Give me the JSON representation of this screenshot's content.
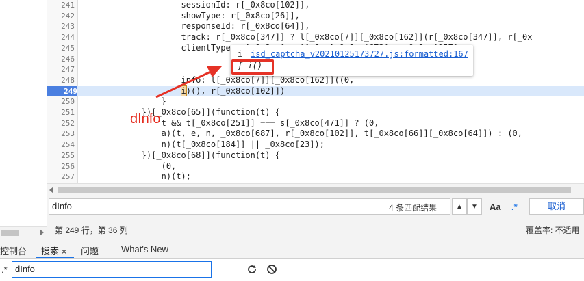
{
  "editor": {
    "lines": [
      {
        "n": "241",
        "code": "                    sessionId: r[_0x8co[102]],"
      },
      {
        "n": "242",
        "code": "                    showType: r[_0x8co[26]],"
      },
      {
        "n": "243",
        "code": "                    responseId: r[_0x8co[64]],"
      },
      {
        "n": "244",
        "code": "                    track: r[_0x8co[347]] ? l[_0x8co[7]][_0x8co[162]](r[_0x8co[347]], r[_0x"
      },
      {
        "n": "245",
        "code": "                    clientType: r[_0x8co[...]] ? r[_0x8co[673] : _0x8co[157],"
      },
      {
        "n": "246",
        "code": "                                                            686] : _0x8co[157],"
      },
      {
        "n": "247",
        "code": ""
      },
      {
        "n": "248",
        "code": "                    info: l[_0x8co[7]][_0x8co[162]]((0,"
      },
      {
        "n": "249",
        "code_pre": "                    ",
        "code_hl": "i",
        "code_post": ")(), r[_0x8co[102]])"
      },
      {
        "n": "250",
        "code": "                }"
      },
      {
        "n": "251",
        "code": "            })[_0x8co[65]](function(t) {"
      },
      {
        "n": "252",
        "code": "                t && t[_0x8co[251]] === s[_0x8co[471]] ? (0,"
      },
      {
        "n": "253",
        "code": "                a)(t, e, n, _0x8co[687], r[_0x8co[102]], t[_0x8co[66]][_0x8co[64]]) : (0,"
      },
      {
        "n": "254",
        "code": "                n)(t[_0x8co[184]] || _0x8co[23]);"
      },
      {
        "n": "255",
        "code": "            })[_0x8co[68]](function(t) {"
      },
      {
        "n": "256",
        "code": "                (0,"
      },
      {
        "n": "257",
        "code": "                n)(t);"
      }
    ]
  },
  "popover": {
    "type_glyph": "i",
    "link": "isd_captcha_v20210125173727.js:formatted:167",
    "fn": "ƒ i()"
  },
  "annotation": {
    "text": "dInfo"
  },
  "findbar": {
    "query": "dInfo",
    "match_count": "4 条匹配结果",
    "prev_label": "▲",
    "next_label": "▼",
    "case_label": "Aa",
    "regex_label": ".*",
    "cancel_label": "取消"
  },
  "statusbar": {
    "position": "第 249 行，第 36 列",
    "coverage": "覆盖率: 不适用"
  },
  "drawer": {
    "tabs": [
      {
        "label": "控制台"
      },
      {
        "label": "搜索",
        "close": "×"
      },
      {
        "label": "问题"
      },
      {
        "label": "What's New"
      }
    ]
  },
  "search": {
    "regex_label": ".*",
    "query": "dInfo"
  },
  "colors": {
    "accent": "#1a73e8",
    "annotation": "#e53226",
    "active_line": "#4a7fe0"
  }
}
